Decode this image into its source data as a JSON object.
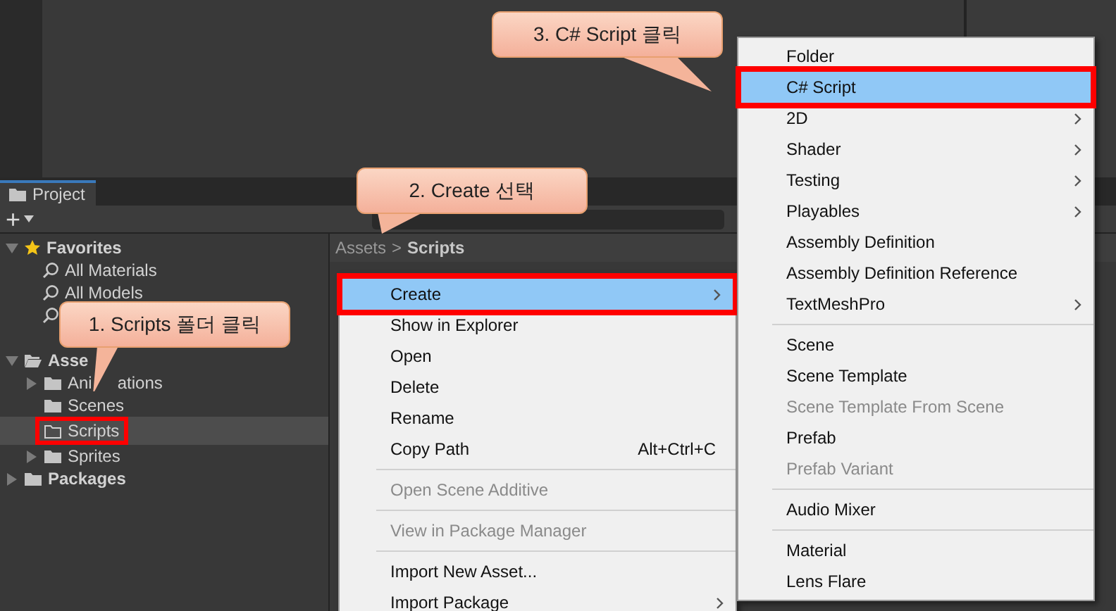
{
  "project_tab": {
    "label": "Project",
    "selected": true
  },
  "toolbar": {
    "add": "+"
  },
  "favorites": {
    "label": "Favorites",
    "expanded": true,
    "items": [
      {
        "kind": "search",
        "label": "All Materials"
      },
      {
        "kind": "search",
        "label": "All Models"
      },
      {
        "kind": "search"
      }
    ]
  },
  "tree": [
    {
      "label": "Asse",
      "expanded": true,
      "children": [
        {
          "label": "Ani",
          "rest": "ations",
          "expanded": false,
          "selected": false
        },
        {
          "label": "Scenes",
          "expanded": false,
          "selected": false,
          "has_children": false
        },
        {
          "label": "Scripts",
          "expanded": false,
          "selected": true,
          "has_children": false
        },
        {
          "label": "Sprites",
          "expanded": false,
          "selected": false,
          "has_children": true
        }
      ]
    },
    {
      "label": "Packages",
      "expanded": false
    }
  ],
  "breadcrumb": {
    "parent": "Assets",
    "separator": ">",
    "current": "Scripts"
  },
  "context_menu": [
    {
      "kind": "item",
      "label": "Create",
      "submenu": true,
      "selected": true,
      "disabled": false
    },
    {
      "kind": "item",
      "label": "Show in Explorer",
      "submenu": false,
      "selected": false,
      "disabled": false
    },
    {
      "kind": "item",
      "label": "Open",
      "submenu": false,
      "selected": false,
      "disabled": false
    },
    {
      "kind": "item",
      "label": "Delete",
      "submenu": false,
      "selected": false,
      "disabled": false
    },
    {
      "kind": "item",
      "label": "Rename",
      "submenu": false,
      "selected": false,
      "disabled": false
    },
    {
      "kind": "item",
      "label": "Copy Path",
      "shortcut": "Alt+Ctrl+C",
      "submenu": false,
      "selected": false,
      "disabled": false
    },
    {
      "kind": "separator"
    },
    {
      "kind": "item",
      "label": "Open Scene Additive",
      "submenu": false,
      "selected": false,
      "disabled": true
    },
    {
      "kind": "separator"
    },
    {
      "kind": "item",
      "label": "View in Package Manager",
      "submenu": false,
      "selected": false,
      "disabled": true
    },
    {
      "kind": "separator"
    },
    {
      "kind": "item",
      "label": "Import New Asset...",
      "submenu": false,
      "selected": false,
      "disabled": false
    },
    {
      "kind": "item",
      "label": "Import Package",
      "submenu": true,
      "selected": false,
      "disabled": false
    }
  ],
  "create_submenu": [
    {
      "kind": "item",
      "label": "Folder",
      "submenu": false,
      "selected": false,
      "disabled": false
    },
    {
      "kind": "item",
      "label": "C# Script",
      "submenu": false,
      "selected": true,
      "disabled": false
    },
    {
      "kind": "item",
      "label": "2D",
      "submenu": true,
      "selected": false,
      "disabled": false
    },
    {
      "kind": "item",
      "label": "Shader",
      "submenu": true,
      "selected": false,
      "disabled": false
    },
    {
      "kind": "item",
      "label": "Testing",
      "submenu": true,
      "selected": false,
      "disabled": false
    },
    {
      "kind": "item",
      "label": "Playables",
      "submenu": true,
      "selected": false,
      "disabled": false
    },
    {
      "kind": "item",
      "label": "Assembly Definition",
      "submenu": false,
      "selected": false,
      "disabled": false
    },
    {
      "kind": "item",
      "label": "Assembly Definition Reference",
      "submenu": false,
      "selected": false,
      "disabled": false
    },
    {
      "kind": "item",
      "label": "TextMeshPro",
      "submenu": true,
      "selected": false,
      "disabled": false
    },
    {
      "kind": "separator"
    },
    {
      "kind": "item",
      "label": "Scene",
      "submenu": false,
      "selected": false,
      "disabled": false
    },
    {
      "kind": "item",
      "label": "Scene Template",
      "submenu": false,
      "selected": false,
      "disabled": false
    },
    {
      "kind": "item",
      "label": "Scene Template From Scene",
      "submenu": false,
      "selected": false,
      "disabled": true
    },
    {
      "kind": "item",
      "label": "Prefab",
      "submenu": false,
      "selected": false,
      "disabled": false
    },
    {
      "kind": "item",
      "label": "Prefab Variant",
      "submenu": false,
      "selected": false,
      "disabled": true
    },
    {
      "kind": "separator"
    },
    {
      "kind": "item",
      "label": "Audio Mixer",
      "submenu": false,
      "selected": false,
      "disabled": false
    },
    {
      "kind": "separator"
    },
    {
      "kind": "item",
      "label": "Material",
      "submenu": false,
      "selected": false,
      "disabled": false
    },
    {
      "kind": "item",
      "label": "Lens Flare",
      "submenu": false,
      "selected": false,
      "disabled": false
    }
  ],
  "callouts": [
    {
      "text": "1. Scripts 폴더 클릭"
    },
    {
      "text": "2. Create 선택"
    },
    {
      "text": "3. C# Script 클릭"
    }
  ]
}
